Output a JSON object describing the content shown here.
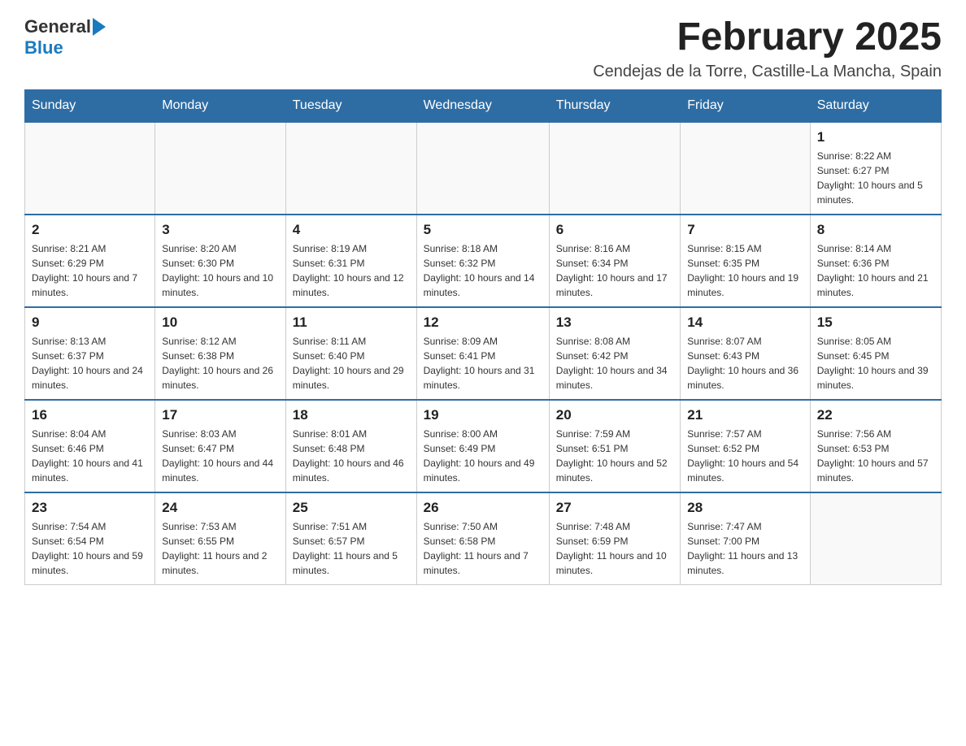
{
  "header": {
    "logo_general": "General",
    "logo_blue": "Blue",
    "month_title": "February 2025",
    "location": "Cendejas de la Torre, Castille-La Mancha, Spain"
  },
  "days_of_week": [
    "Sunday",
    "Monday",
    "Tuesday",
    "Wednesday",
    "Thursday",
    "Friday",
    "Saturday"
  ],
  "weeks": [
    [
      {
        "day": "",
        "info": ""
      },
      {
        "day": "",
        "info": ""
      },
      {
        "day": "",
        "info": ""
      },
      {
        "day": "",
        "info": ""
      },
      {
        "day": "",
        "info": ""
      },
      {
        "day": "",
        "info": ""
      },
      {
        "day": "1",
        "info": "Sunrise: 8:22 AM\nSunset: 6:27 PM\nDaylight: 10 hours and 5 minutes."
      }
    ],
    [
      {
        "day": "2",
        "info": "Sunrise: 8:21 AM\nSunset: 6:29 PM\nDaylight: 10 hours and 7 minutes."
      },
      {
        "day": "3",
        "info": "Sunrise: 8:20 AM\nSunset: 6:30 PM\nDaylight: 10 hours and 10 minutes."
      },
      {
        "day": "4",
        "info": "Sunrise: 8:19 AM\nSunset: 6:31 PM\nDaylight: 10 hours and 12 minutes."
      },
      {
        "day": "5",
        "info": "Sunrise: 8:18 AM\nSunset: 6:32 PM\nDaylight: 10 hours and 14 minutes."
      },
      {
        "day": "6",
        "info": "Sunrise: 8:16 AM\nSunset: 6:34 PM\nDaylight: 10 hours and 17 minutes."
      },
      {
        "day": "7",
        "info": "Sunrise: 8:15 AM\nSunset: 6:35 PM\nDaylight: 10 hours and 19 minutes."
      },
      {
        "day": "8",
        "info": "Sunrise: 8:14 AM\nSunset: 6:36 PM\nDaylight: 10 hours and 21 minutes."
      }
    ],
    [
      {
        "day": "9",
        "info": "Sunrise: 8:13 AM\nSunset: 6:37 PM\nDaylight: 10 hours and 24 minutes."
      },
      {
        "day": "10",
        "info": "Sunrise: 8:12 AM\nSunset: 6:38 PM\nDaylight: 10 hours and 26 minutes."
      },
      {
        "day": "11",
        "info": "Sunrise: 8:11 AM\nSunset: 6:40 PM\nDaylight: 10 hours and 29 minutes."
      },
      {
        "day": "12",
        "info": "Sunrise: 8:09 AM\nSunset: 6:41 PM\nDaylight: 10 hours and 31 minutes."
      },
      {
        "day": "13",
        "info": "Sunrise: 8:08 AM\nSunset: 6:42 PM\nDaylight: 10 hours and 34 minutes."
      },
      {
        "day": "14",
        "info": "Sunrise: 8:07 AM\nSunset: 6:43 PM\nDaylight: 10 hours and 36 minutes."
      },
      {
        "day": "15",
        "info": "Sunrise: 8:05 AM\nSunset: 6:45 PM\nDaylight: 10 hours and 39 minutes."
      }
    ],
    [
      {
        "day": "16",
        "info": "Sunrise: 8:04 AM\nSunset: 6:46 PM\nDaylight: 10 hours and 41 minutes."
      },
      {
        "day": "17",
        "info": "Sunrise: 8:03 AM\nSunset: 6:47 PM\nDaylight: 10 hours and 44 minutes."
      },
      {
        "day": "18",
        "info": "Sunrise: 8:01 AM\nSunset: 6:48 PM\nDaylight: 10 hours and 46 minutes."
      },
      {
        "day": "19",
        "info": "Sunrise: 8:00 AM\nSunset: 6:49 PM\nDaylight: 10 hours and 49 minutes."
      },
      {
        "day": "20",
        "info": "Sunrise: 7:59 AM\nSunset: 6:51 PM\nDaylight: 10 hours and 52 minutes."
      },
      {
        "day": "21",
        "info": "Sunrise: 7:57 AM\nSunset: 6:52 PM\nDaylight: 10 hours and 54 minutes."
      },
      {
        "day": "22",
        "info": "Sunrise: 7:56 AM\nSunset: 6:53 PM\nDaylight: 10 hours and 57 minutes."
      }
    ],
    [
      {
        "day": "23",
        "info": "Sunrise: 7:54 AM\nSunset: 6:54 PM\nDaylight: 10 hours and 59 minutes."
      },
      {
        "day": "24",
        "info": "Sunrise: 7:53 AM\nSunset: 6:55 PM\nDaylight: 11 hours and 2 minutes."
      },
      {
        "day": "25",
        "info": "Sunrise: 7:51 AM\nSunset: 6:57 PM\nDaylight: 11 hours and 5 minutes."
      },
      {
        "day": "26",
        "info": "Sunrise: 7:50 AM\nSunset: 6:58 PM\nDaylight: 11 hours and 7 minutes."
      },
      {
        "day": "27",
        "info": "Sunrise: 7:48 AM\nSunset: 6:59 PM\nDaylight: 11 hours and 10 minutes."
      },
      {
        "day": "28",
        "info": "Sunrise: 7:47 AM\nSunset: 7:00 PM\nDaylight: 11 hours and 13 minutes."
      },
      {
        "day": "",
        "info": ""
      }
    ]
  ]
}
